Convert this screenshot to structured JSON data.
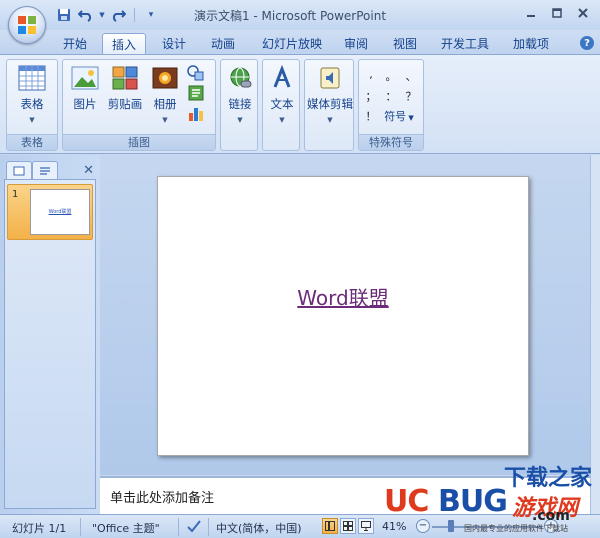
{
  "window": {
    "title": "演示文稿1 - Microsoft PowerPoint"
  },
  "qat": {
    "icons": [
      "save-icon",
      "undo-icon",
      "redo-icon",
      "customize-qat-icon"
    ]
  },
  "tabs": [
    {
      "label": "开始",
      "active": false
    },
    {
      "label": "插入",
      "active": true
    },
    {
      "label": "设计",
      "active": false
    },
    {
      "label": "动画",
      "active": false
    },
    {
      "label": "幻灯片放映",
      "active": false
    },
    {
      "label": "审阅",
      "active": false
    },
    {
      "label": "视图",
      "active": false
    },
    {
      "label": "开发工具",
      "active": false
    },
    {
      "label": "加载项",
      "active": false
    }
  ],
  "ribbon": {
    "groups": {
      "tables": {
        "label": "表格",
        "buttons": {
          "table": "表格"
        }
      },
      "illustrations": {
        "label": "插图",
        "buttons": {
          "picture": "图片",
          "clipart": "剪贴画",
          "album": "相册"
        }
      },
      "links": {
        "buttons": {
          "link": "链接"
        }
      },
      "text": {
        "buttons": {
          "text": "文本"
        }
      },
      "media": {
        "buttons": {
          "media": "媒体剪辑"
        }
      },
      "special_symbols": {
        "label": "特殊符号",
        "symbols": [
          ",",
          "。",
          "、",
          "；",
          "：",
          "？",
          "！"
        ],
        "symbol_button": "符号"
      }
    }
  },
  "slides_pane": {
    "slide_number": "1",
    "thumb_text": "Word联盟"
  },
  "slide": {
    "text": "Word联盟"
  },
  "notes": {
    "placeholder": "单击此处添加备注"
  },
  "status": {
    "slide_info": "幻灯片 1/1",
    "theme": "\"Office 主题\"",
    "language": "中文(简体，中国)",
    "zoom": "41%",
    "zoom_minus": "−",
    "zoom_plus": "+",
    "footer_text": "国内最专业的应用软件下载站"
  },
  "watermark": {
    "top": "下载之家",
    "brand_uc": "UC",
    "brand_bug": "BUG",
    "cn": "游戏网",
    "com": ".com"
  },
  "colors": {
    "slide_text": "#6b2d7a",
    "ribbon_text": "#15428b",
    "active_view": "#f3b148"
  }
}
